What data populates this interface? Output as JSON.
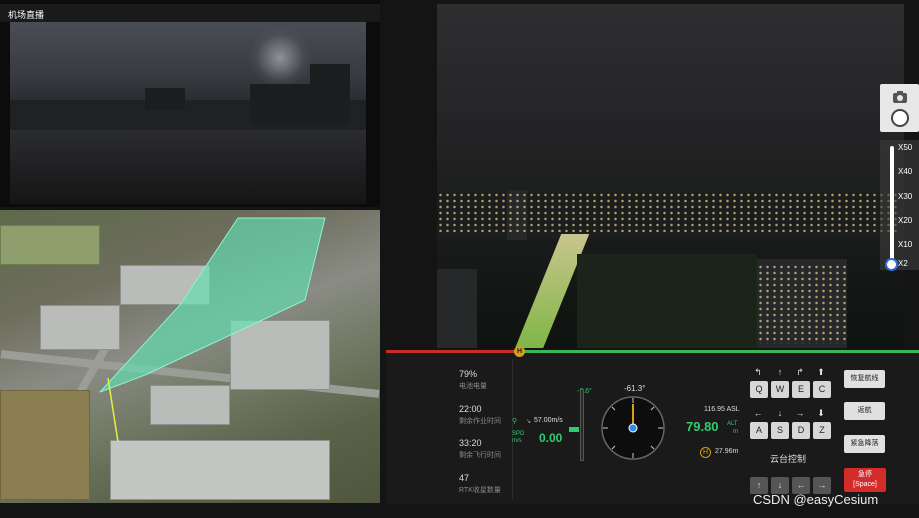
{
  "airport": {
    "title": "机场直播"
  },
  "zoom": {
    "labels": [
      "X50",
      "X40",
      "X30",
      "X20",
      "X10",
      "X2"
    ],
    "current": "X2"
  },
  "stats": [
    {
      "value": "79%",
      "label": "电池电量"
    },
    {
      "value": "22:00",
      "label": "剩余作业时间"
    },
    {
      "value": "33:20",
      "label": "剩余飞行时间"
    },
    {
      "value": "47",
      "label": "RTK收星数量"
    }
  ],
  "flight": {
    "spd_label": "SPD",
    "spd_unit": "m/s",
    "speed": "0.00",
    "wind_speed": "57.00m/s",
    "vertical": "-3.6°",
    "heading": "-61.3°",
    "asl": "116.95 ASL",
    "alt": "79.80",
    "alt_label": "ALT",
    "alt_unit": "m",
    "home_dist": "27.96m",
    "home_marker": "H"
  },
  "keypad": {
    "row1": [
      "↰",
      "↑",
      "↱",
      "⬆"
    ],
    "row2": [
      "Q",
      "W",
      "E",
      "C"
    ],
    "row3": [
      "←",
      "↓",
      "→",
      "⬇"
    ],
    "row4": [
      "A",
      "S",
      "D",
      "Z"
    ],
    "gimbal_label": "云台控制",
    "row5": [
      "↑",
      "↓",
      "←",
      "→"
    ]
  },
  "buttons": {
    "resume": "恢复航线",
    "return_home": "返航",
    "emergency_land": "紧急降落",
    "estop_line1": "急停",
    "estop_line2": "[Space]"
  },
  "watermark": "CSDN @easyCesium",
  "colors": {
    "accent_green": "#2ecc71",
    "danger": "#d42b2b",
    "fov": "#5fe0b0"
  }
}
